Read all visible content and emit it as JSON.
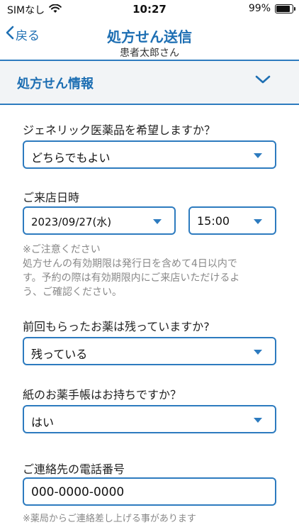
{
  "status": {
    "carrier": "SIMなし",
    "time": "10:27",
    "battery": "99%",
    "battery_level": 0.99
  },
  "nav": {
    "back": "戻る",
    "title": "処方せん送信",
    "subtitle": "患者太郎さん"
  },
  "section": {
    "title": "処方せん情報"
  },
  "generic": {
    "label": "ジェネリック医薬品を希望しますか？",
    "value": "どちらでもよい"
  },
  "visit": {
    "label": "ご来店日時",
    "date": "2023/09/27(水)",
    "time": "15:00",
    "note_title": "※ご注意ください",
    "note_line1": "処方せんの有効期限は発行日を含めて4日以内で",
    "note_line2": "す。予約の際は有効期限内にご来店いただけるよ",
    "note_line3": "う、ご確認ください。"
  },
  "leftover": {
    "label": "前回もらったお薬は残っていますか?",
    "value": "残っている"
  },
  "notebook": {
    "label": "紙のお薬手帳はお持ちですか？",
    "value": "はい"
  },
  "phone": {
    "label": "ご連絡先の電話番号",
    "value": "000-0000-0000",
    "note": "※薬局からご連絡差し上げる事があります"
  },
  "colors": {
    "accent": "#1e6fb3",
    "border": "#2d7bbf",
    "note": "#888888"
  }
}
